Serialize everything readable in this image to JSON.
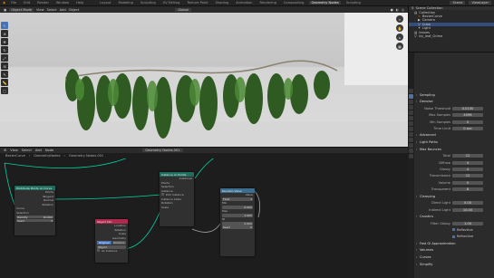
{
  "menubar": {
    "items": [
      "File",
      "Edit",
      "Render",
      "Window",
      "Help"
    ],
    "workspaces": [
      "Layout",
      "Modeling",
      "Sculpting",
      "UV Editing",
      "Texture Paint",
      "Shading",
      "Animation",
      "Rendering",
      "Compositing",
      "Geometry Nodes",
      "Scripting"
    ],
    "active_workspace": "Geometry Nodes",
    "scene": "Scene",
    "view_layer": "ViewLayer"
  },
  "viewport": {
    "mode": "Object Mode",
    "menus": [
      "View",
      "Select",
      "Add",
      "Object"
    ],
    "orientation": "Global",
    "tools": [
      "cursor-icon",
      "move-icon",
      "rotate-icon",
      "scale-icon",
      "transform-icon",
      "annotate-icon",
      "measure-icon",
      "add-cube-icon"
    ]
  },
  "node_editor": {
    "menus": [
      "View",
      "Select",
      "Add",
      "Node"
    ],
    "breadcrumb": [
      "BezierCurve",
      "GeometryNodes"
    ],
    "tree_name": "Geometry Nodes.001",
    "nodes": {
      "n1": {
        "title": "Distribute Points on Curve",
        "rows": [
          "Points",
          "Tangent",
          "Normal",
          "Rotation"
        ],
        "fields": [
          "Curve",
          "Selection",
          "Density",
          "Seed"
        ],
        "values": [
          "10.000",
          "3"
        ]
      },
      "n2": {
        "title": "Object Info",
        "rows": [
          "Location",
          "Rotation",
          "Scale",
          "Geometry"
        ],
        "buttons": [
          "Original",
          "Relative"
        ],
        "fields": [
          "Object",
          "As Instance"
        ]
      },
      "n3": {
        "title": "Instance on Points",
        "rows": [
          "Instances",
          "Points",
          "Selection",
          "Instance",
          "Pick Instance",
          "Instance Index",
          "Rotation",
          "Scale"
        ]
      },
      "n4": {
        "title": "Random Value",
        "rows": [
          "Value",
          "Float",
          "Min",
          "Max",
          "ID",
          "Seed"
        ],
        "values": [
          "0.000",
          "1.000",
          "0.000",
          "0"
        ]
      }
    }
  },
  "outliner": {
    "title": "Scene Collection",
    "items": [
      "Collection",
      "BezierCurve",
      "Camera",
      "Cube",
      "Light",
      "leaves",
      "Ivy_leaf_Grime"
    ]
  },
  "properties": {
    "rows": [
      {
        "type": "section",
        "label": "Sampling"
      },
      {
        "type": "section",
        "label": "Denoise"
      },
      {
        "type": "field",
        "label": "Noise Threshold",
        "value": "0.0100"
      },
      {
        "type": "field",
        "label": "Max Samples",
        "value": "4096"
      },
      {
        "type": "field",
        "label": "Min Samples",
        "value": "0"
      },
      {
        "type": "field",
        "label": "Time Limit",
        "value": "0 sec"
      },
      {
        "type": "section",
        "label": "Advanced"
      },
      {
        "type": "section",
        "label": "Light Paths"
      },
      {
        "type": "section",
        "label": "Max Bounces"
      },
      {
        "type": "field",
        "label": "Total",
        "value": "12"
      },
      {
        "type": "field",
        "label": "Diffuse",
        "value": "4"
      },
      {
        "type": "field",
        "label": "Glossy",
        "value": "4"
      },
      {
        "type": "field",
        "label": "Transmission",
        "value": "12"
      },
      {
        "type": "field",
        "label": "Volume",
        "value": "0"
      },
      {
        "type": "field",
        "label": "Transparent",
        "value": "8"
      },
      {
        "type": "section",
        "label": "Clamping"
      },
      {
        "type": "field",
        "label": "Direct Light",
        "value": "0.00"
      },
      {
        "type": "field",
        "label": "Indirect Light",
        "value": "10.00"
      },
      {
        "type": "section",
        "label": "Caustics"
      },
      {
        "type": "field",
        "label": "Filter Glossy",
        "value": "1.00"
      },
      {
        "type": "check",
        "label": "Reflective"
      },
      {
        "type": "check",
        "label": "Refractive"
      },
      {
        "type": "section",
        "label": "Fast GI Approximation"
      },
      {
        "type": "section",
        "label": "Volumes"
      },
      {
        "type": "section",
        "label": "Curves"
      },
      {
        "type": "section",
        "label": "Simplify"
      }
    ],
    "check_label": "Caustics"
  }
}
